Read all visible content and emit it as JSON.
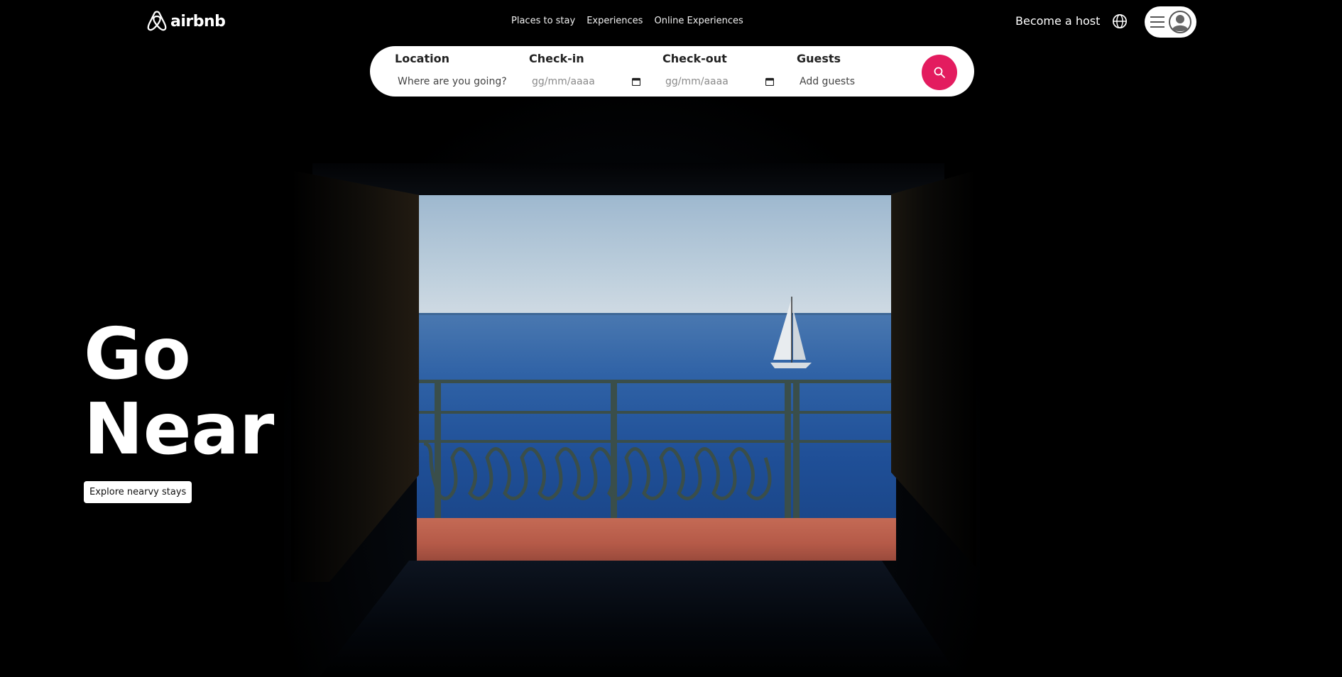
{
  "brand": {
    "name": "airbnb",
    "icon": "airbnb-logo-icon",
    "accent": "#e31c5f"
  },
  "nav": {
    "items": [
      "Places to stay",
      "Experiences",
      "Online Experiences"
    ]
  },
  "header": {
    "become_host": "Become a host",
    "globe_icon": "globe-icon",
    "menu_icon": "hamburger-icon",
    "avatar_icon": "user-avatar-icon"
  },
  "search": {
    "location": {
      "label": "Location",
      "placeholder": "Where are you going?"
    },
    "checkin": {
      "label": "Check-in",
      "placeholder": "gg/mm/aaaa"
    },
    "checkout": {
      "label": "Check-out",
      "placeholder": "gg/mm/aaaa"
    },
    "guests": {
      "label": "Guests",
      "placeholder": "Add guests"
    },
    "button_icon": "search-icon"
  },
  "hero": {
    "headline_line1": "Go",
    "headline_line2": "Near",
    "cta": "Explore nearvy stays",
    "image": "tunnel-sea-sailboat-photo"
  }
}
